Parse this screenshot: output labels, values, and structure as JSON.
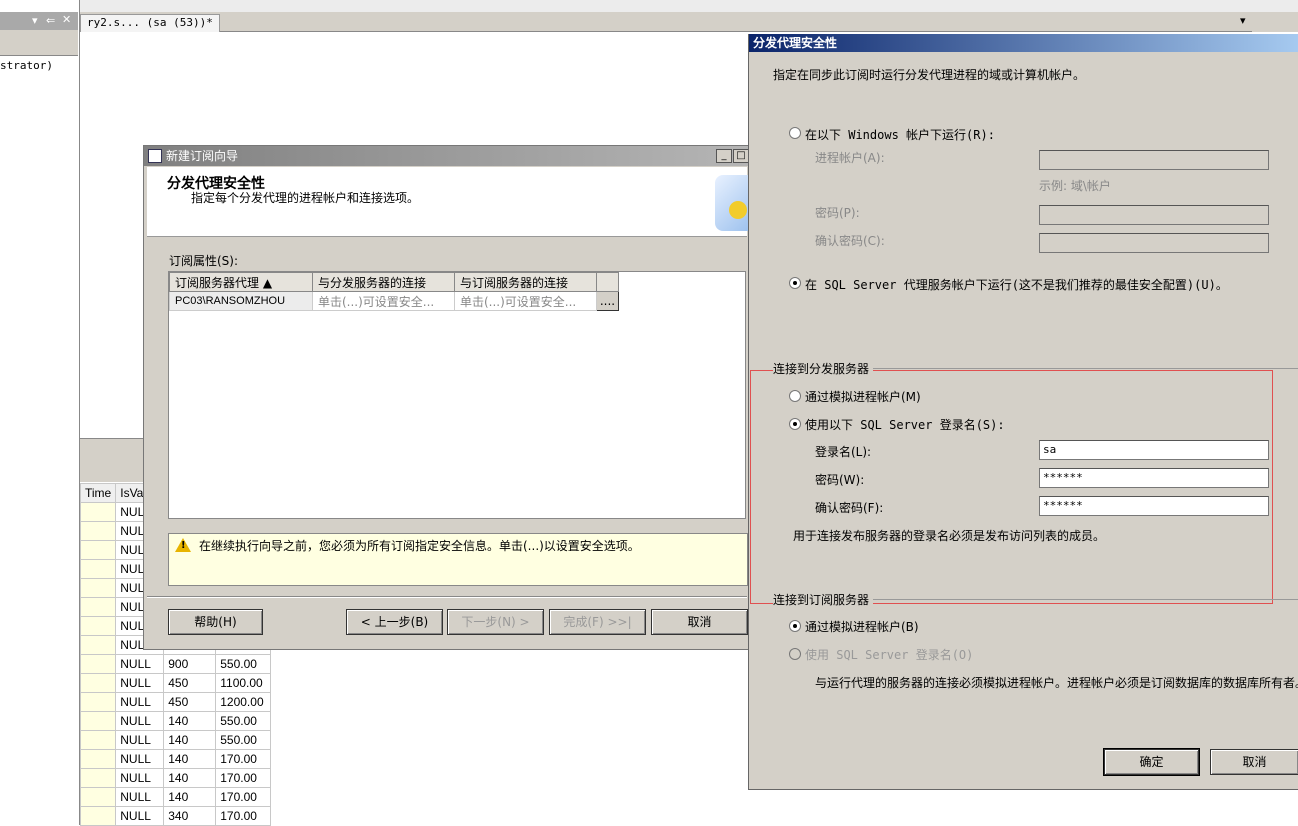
{
  "left_pane": {
    "text": "strator)"
  },
  "query_tab": {
    "label": "ry2.s... (sa (53))*"
  },
  "results": {
    "headers": [
      "Time",
      "IsVal"
    ],
    "rows": [
      [
        "",
        "NULL",
        "",
        ""
      ],
      [
        "",
        "NULL",
        "",
        ""
      ],
      [
        "",
        "NULL",
        "",
        ""
      ],
      [
        "",
        "NULL",
        "",
        ""
      ],
      [
        "",
        "NULL",
        "",
        ""
      ],
      [
        "",
        "NULL",
        "",
        ""
      ],
      [
        "",
        "NULL",
        "",
        ""
      ],
      [
        "",
        "NULL",
        "",
        ""
      ],
      [
        "",
        "NULL",
        "900",
        "550.00"
      ],
      [
        "",
        "NULL",
        "450",
        "1100.00"
      ],
      [
        "",
        "NULL",
        "450",
        "1200.00"
      ],
      [
        "",
        "NULL",
        "140",
        "550.00"
      ],
      [
        "",
        "NULL",
        "140",
        "550.00"
      ],
      [
        "",
        "NULL",
        "140",
        "170.00"
      ],
      [
        "",
        "NULL",
        "140",
        "170.00"
      ],
      [
        "",
        "NULL",
        "140",
        "170.00"
      ],
      [
        "",
        "NULL",
        "340",
        "170.00"
      ]
    ]
  },
  "wizard": {
    "title": "新建订阅向导",
    "heading": "分发代理安全性",
    "subheading": "指定每个分发代理的进程帐户和连接选项。",
    "props_label": "订阅属性(S):",
    "grid": {
      "headers": [
        "订阅服务器代理  ▲",
        "与分发服务器的连接",
        "与订阅服务器的连接"
      ],
      "rows": [
        [
          "PC03\\RANSOMZHOU",
          "单击(...)可设置安全...",
          "单击(...)可设置安全..."
        ]
      ],
      "ellipsis": "...."
    },
    "warning": "在继续执行向导之前，您必须为所有订阅指定安全信息。单击(...)以设置安全选项。",
    "buttons": {
      "help": "帮助(H)",
      "back": "< 上一步(B)",
      "next": "下一步(N) >",
      "finish": "完成(F) >>|",
      "cancel": "取消"
    }
  },
  "security": {
    "title": "分发代理安全性",
    "description": "指定在同步此订阅时运行分发代理进程的域或计算机帐户。",
    "run_as_windows": "在以下 Windows 帐户下运行(R):",
    "process_account_label": "进程帐户(A):",
    "example": "示例: 域\\帐户",
    "password_label": "密码(P):",
    "confirm_password_label": "确认密码(C):",
    "run_as_agent": "在 SQL Server 代理服务帐户下运行(这不是我们推荐的最佳安全配置)(U)。",
    "distributor_group": "连接到分发服务器",
    "impersonate_dist": "通过模拟进程帐户(M)",
    "use_sql_login": "使用以下 SQL Server 登录名(S):",
    "login_label": "登录名(L):",
    "login_value": "sa",
    "dist_password_label": "密码(W):",
    "dist_password_value": "******",
    "dist_confirm_label": "确认密码(F):",
    "dist_confirm_value": "******",
    "login_note": "用于连接发布服务器的登录名必须是发布访问列表的成员。",
    "subscriber_group": "连接到订阅服务器",
    "impersonate_sub": "通过模拟进程帐户(B)",
    "use_sql_login_sub": "使用 SQL Server 登录名(O)",
    "subscriber_note": "与运行代理的服务器的连接必须模拟进程帐户。进程帐户必须是订阅数据库的数据库所有者。",
    "ok": "确定",
    "cancel": "取消"
  },
  "colors": {
    "title_active_start": "#0a246a",
    "title_active_end": "#a6caf0",
    "dialog_bg": "#d4d0c8",
    "highlight_border": "#e05050",
    "warning_bg": "#ffffe1"
  }
}
